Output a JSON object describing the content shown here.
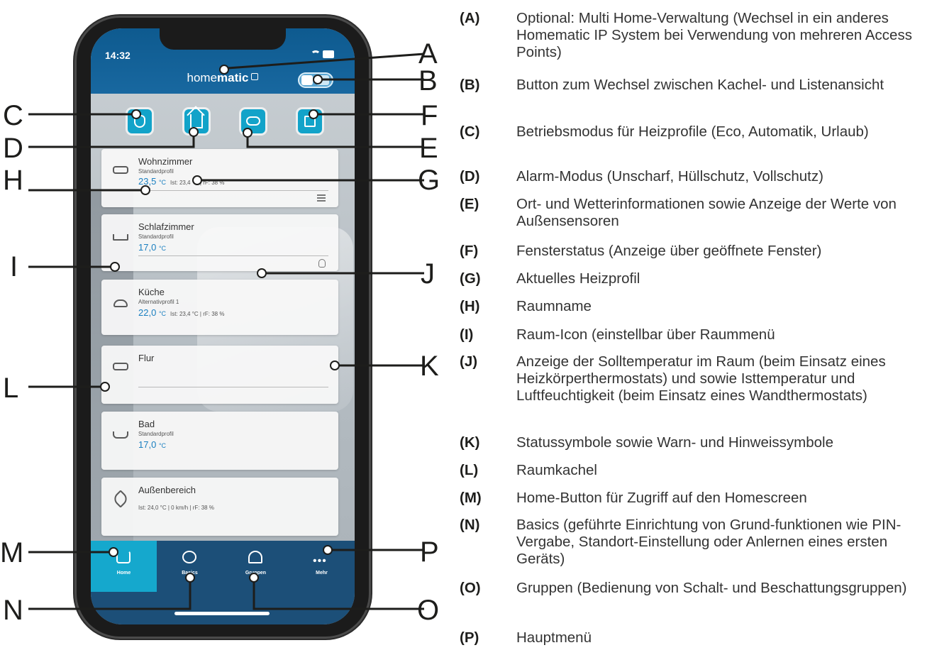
{
  "phone": {
    "time": "14:32",
    "brand_prefix": "home",
    "brand_suffix": "matic",
    "rooms": [
      {
        "name": "Wohnzimmer",
        "profile": "Standardprofil",
        "temp": "23,5",
        "unit": "°C",
        "ist": "Ist: 23,4 °C | rF: 38 %",
        "icon": "sofa-icon"
      },
      {
        "name": "Schlafzimmer",
        "profile": "Standardprofil",
        "temp": "17,0",
        "unit": "°C",
        "ist": "",
        "icon": "bed-icon"
      },
      {
        "name": "Küche",
        "profile": "Alternativprofil 1",
        "temp": "22,0",
        "unit": "°C",
        "ist": "Ist: 23,4 °C | rF: 38 %",
        "icon": "pot-icon"
      },
      {
        "name": "Flur",
        "profile": "",
        "temp": "",
        "unit": "",
        "ist": "",
        "icon": "sofa-icon"
      },
      {
        "name": "Bad",
        "profile": "Standardprofil",
        "temp": "17,0",
        "unit": "°C",
        "ist": "",
        "icon": "bathtub-icon"
      },
      {
        "name": "Außenbereich",
        "profile": "",
        "temp": "",
        "unit": "",
        "ist": "Ist: 24,0 °C | 0 km/h | rF: 38 %",
        "icon": "bird-icon"
      }
    ],
    "tabs": [
      {
        "label": "Home",
        "icon": "home-icon"
      },
      {
        "label": "Basics",
        "icon": "gear-icon"
      },
      {
        "label": "Gruppen",
        "icon": "lamp-icon"
      },
      {
        "label": "Mehr",
        "icon": "more-icon"
      }
    ]
  },
  "markers": {
    "A": "A",
    "B": "B",
    "C": "C",
    "D": "D",
    "E": "E",
    "F": "F",
    "G": "G",
    "H": "H",
    "I": "I",
    "J": "J",
    "K": "K",
    "L": "L",
    "M": "M",
    "N": "N",
    "O": "O",
    "P": "P"
  },
  "legend": [
    {
      "key": "(A)",
      "text": "Optional: Multi Home-Verwaltung (Wechsel in ein anderes Homematic IP System bei Verwendung von mehreren Access Points)"
    },
    {
      "key": "(B)",
      "text": "Button zum Wechsel zwischen Kachel- und Listenansicht"
    },
    {
      "key": "(C)",
      "text": "Betriebsmodus für Heizprofile (Eco, Automatik, Urlaub)"
    },
    {
      "key": "(D)",
      "text": "Alarm-Modus (Unscharf, Hüllschutz, Vollschutz)"
    },
    {
      "key": "(E)",
      "text": "Ort- und Wetterinformationen sowie Anzeige der Werte von Außensensoren"
    },
    {
      "key": "(F)",
      "text": "Fensterstatus (Anzeige über geöffnete Fenster)"
    },
    {
      "key": "(G)",
      "text": "Aktuelles Heizprofil"
    },
    {
      "key": "(H)",
      "text": "Raumname"
    },
    {
      "key": "(I)",
      "text": "Raum-Icon (einstellbar über Raummenü"
    },
    {
      "key": "(J)",
      "text": "Anzeige der Solltemperatur im Raum (beim Einsatz eines Heizkörperthermostats) und sowie Isttemperatur und Luftfeuchtigkeit (beim Einsatz eines Wandthermostats)"
    },
    {
      "key": "(K)",
      "text": "Statussymbole sowie Warn- und Hinweissymbole"
    },
    {
      "key": "(L)",
      "text": "Raumkachel"
    },
    {
      "key": "(M)",
      "text": "Home-Button für Zugriff auf den Homescreen"
    },
    {
      "key": "(N)",
      "text": "Basics (geführte Einrichtung von Grund-funktionen wie PIN-Vergabe, Standort-Einstellung oder Anlernen eines ersten Geräts)"
    },
    {
      "key": "(O)",
      "text": "Gruppen (Bedienung von Schalt- und Beschattungsgruppen)"
    },
    {
      "key": "(P)",
      "text": "Hauptmenü"
    }
  ]
}
